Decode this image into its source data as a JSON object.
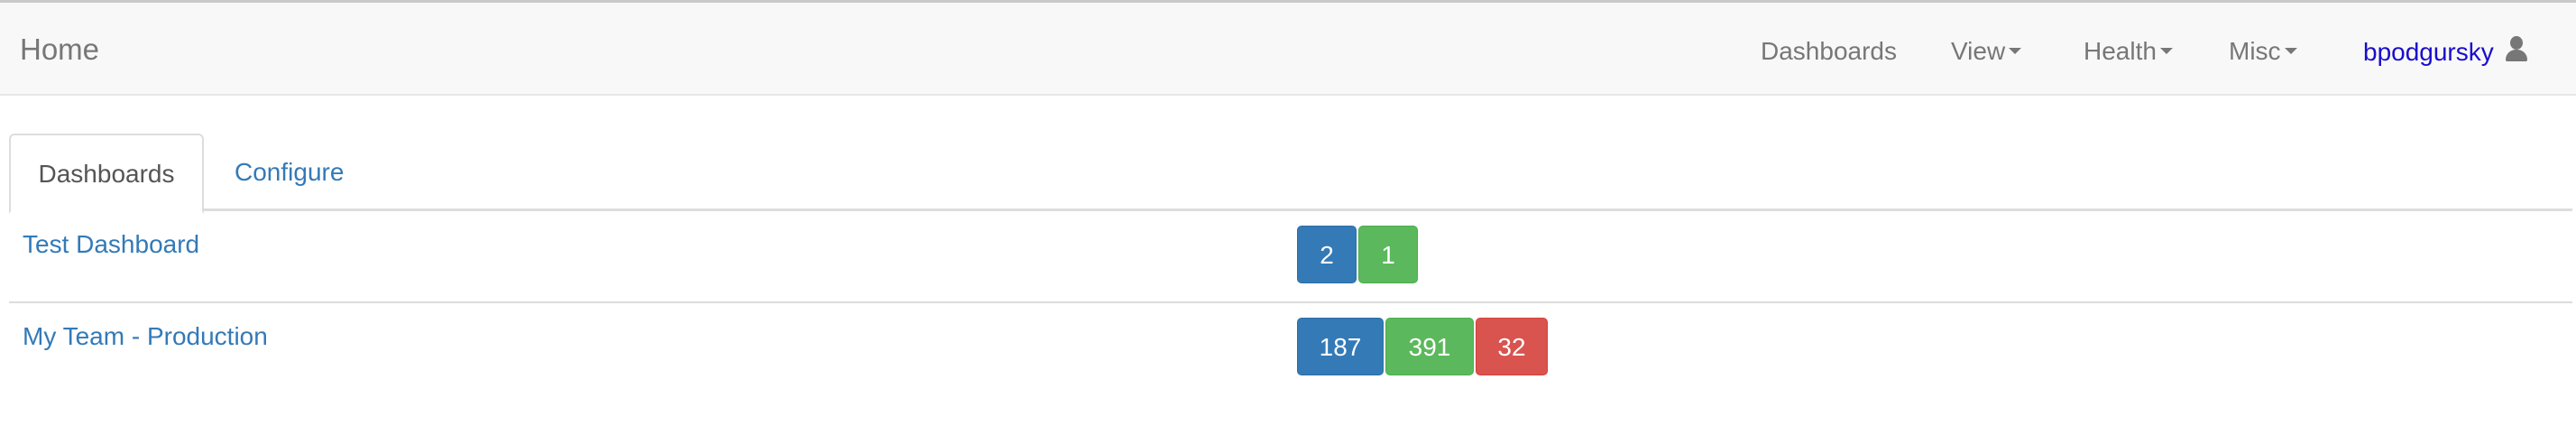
{
  "navbar": {
    "brand": "Home",
    "items": [
      {
        "label": "Dashboards",
        "dropdown": false
      },
      {
        "label": "View",
        "dropdown": true
      },
      {
        "label": "Health",
        "dropdown": true
      },
      {
        "label": "Misc",
        "dropdown": true
      }
    ],
    "user": {
      "label": "bpodgursky",
      "icon": "user-icon"
    }
  },
  "tabs": [
    {
      "label": "Dashboards",
      "active": true
    },
    {
      "label": "Configure",
      "active": false
    }
  ],
  "dashboards": [
    {
      "name": "Test Dashboard",
      "counts": [
        {
          "value": "2",
          "color": "#337ab7"
        },
        {
          "value": "1",
          "color": "#5cb85c"
        }
      ]
    },
    {
      "name": "My Team - Production",
      "counts": [
        {
          "value": "187",
          "color": "#337ab7"
        },
        {
          "value": "391",
          "color": "#5cb85c"
        },
        {
          "value": "32",
          "color": "#d9534f"
        }
      ]
    }
  ]
}
